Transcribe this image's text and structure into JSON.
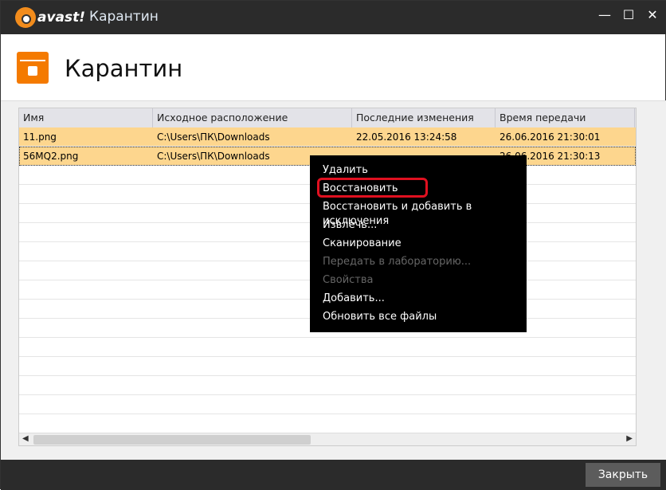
{
  "titlebar": {
    "brand": "avast!",
    "title": "Карантин"
  },
  "header": {
    "title": "Карантин"
  },
  "table": {
    "columns": [
      "Имя",
      "Исходное расположение",
      "Последние изменения",
      "Время передачи"
    ],
    "rows": [
      {
        "name": "11.png",
        "location": "C:\\Users\\ПК\\Downloads",
        "modified": "22.05.2016 13:24:58",
        "sent": "26.06.2016 21:30:01"
      },
      {
        "name": "56MQ2.png",
        "location": "C:\\Users\\ПК\\Downloads",
        "modified": "",
        "sent": "26.06.2016 21:30:13"
      }
    ]
  },
  "context_menu": {
    "items": [
      "Удалить",
      "Восстановить",
      "Восстановить и добавить в исключения",
      "Извлечь...",
      "Сканирование",
      "Передать в лабораторию...",
      "Свойства",
      "Добавить...",
      "Обновить все файлы"
    ]
  },
  "footer": {
    "close_label": "Закрыть"
  }
}
